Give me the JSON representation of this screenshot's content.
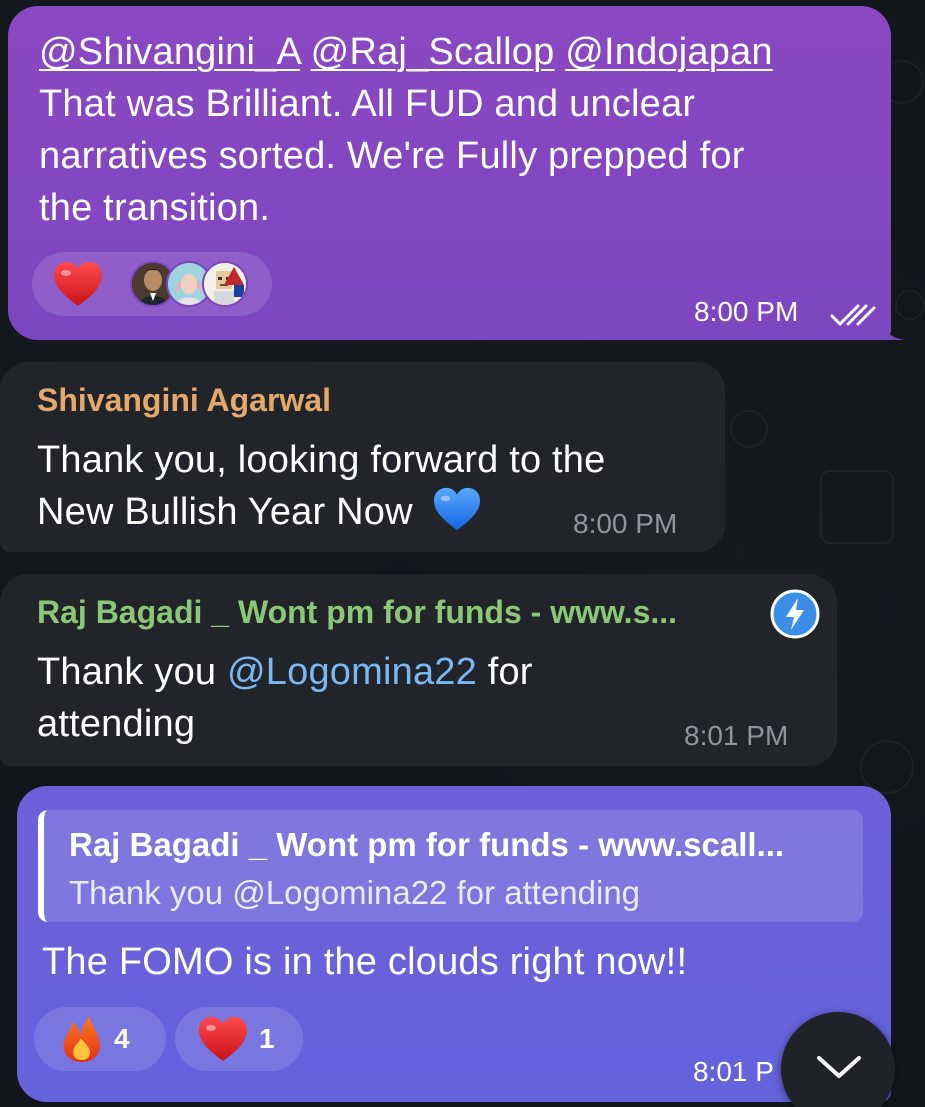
{
  "messages": [
    {
      "id": "m1",
      "direction": "outgoing",
      "mentions": [
        "@Shivangini_A",
        "@Raj_Scallop",
        "@Indojapan"
      ],
      "text_lines": [
        "That was Brilliant. All FUD and unclear",
        "narratives sorted. We're Fully prepped for",
        "the transition."
      ],
      "reaction": {
        "emoji": "heart-icon",
        "avatars": [
          "avatar-man",
          "avatar-woman",
          "avatar-pixel"
        ]
      },
      "time": "8:00 PM",
      "status": "read-double-check-icon"
    },
    {
      "id": "m2",
      "direction": "incoming",
      "sender": "Shivangini Agarwal",
      "sender_color": "#e3a86b",
      "text_lines": [
        "Thank you, looking forward to the",
        "New Bullish Year Now"
      ],
      "emoji": "blue-heart-icon",
      "time": "8:00 PM"
    },
    {
      "id": "m3",
      "direction": "incoming",
      "sender": "Raj Bagadi _ Wont pm for funds - www.s...",
      "sender_color": "#8bc777",
      "badge": "verified-bolt-icon",
      "text_prefix": "Thank you ",
      "mention": "@Logomina22",
      "text_suffix": " for",
      "text_line2": "attending",
      "time": "8:01 PM"
    },
    {
      "id": "m4",
      "direction": "outgoing",
      "reply_sender": "Raj Bagadi _ Wont pm for funds - www.scall...",
      "reply_text": "Thank you @Logomina22 for attending",
      "text": "The FOMO is in the clouds right now!!",
      "reactions": [
        {
          "emoji": "fire-icon",
          "count": "4"
        },
        {
          "emoji": "heart-icon",
          "count": "1"
        }
      ],
      "time": "8:01 P"
    }
  ],
  "scroll_button": {
    "icon": "chevron-down-icon"
  }
}
